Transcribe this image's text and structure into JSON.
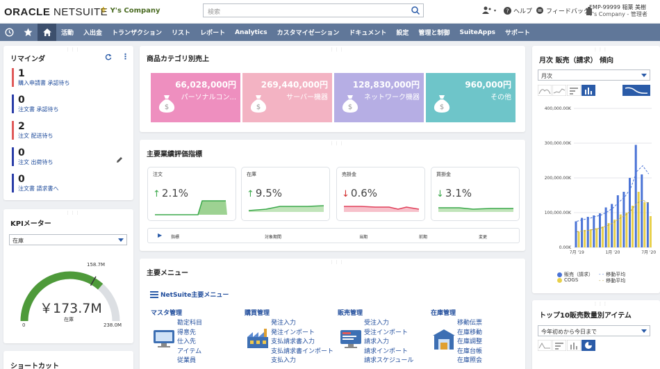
{
  "header": {
    "logo_oracle": "ORACLE",
    "logo_netsuite": "NETSUITE",
    "company": "Y's Company",
    "search_placeholder": "検索",
    "help": "ヘルプ",
    "feedback": "フィードバック",
    "user_name": "EMP-99999 稲葉 美樹",
    "user_role": "Y's Company - 管理者"
  },
  "nav": {
    "items": [
      "活動",
      "入出金",
      "トランザクション",
      "リスト",
      "レポート",
      "Analytics",
      "カスタマイゼーション",
      "ドキュメント",
      "設定",
      "管理と制御",
      "SuiteApps",
      "サポート"
    ]
  },
  "reminders": {
    "title": "リマインダ",
    "items": [
      {
        "count": "1",
        "label": "購入申請書 承認待ち",
        "color": "#e05a5a"
      },
      {
        "count": "0",
        "label": "注文書 承認待ち",
        "color": "#2a3da8"
      },
      {
        "count": "2",
        "label": "注文 配送待ち",
        "color": "#e05a5a"
      },
      {
        "count": "0",
        "label": "注文 出荷待ち",
        "color": "#2a3da8"
      },
      {
        "count": "0",
        "label": "注文書 請求書へ",
        "color": "#2a3da8"
      }
    ]
  },
  "kpi_meter": {
    "title": "KPIメーター",
    "select_value": "在庫",
    "value": "￥173.7M",
    "label": "在庫",
    "min": "0",
    "max": "238.0M",
    "target": "158.7M"
  },
  "shortcut": {
    "title": "ショートカット"
  },
  "category_sales": {
    "title": "商品カテゴリ別売上",
    "tiles": [
      {
        "amount": "66,028,000円",
        "name": "パーソナルコン...",
        "color": "#ee8fbf"
      },
      {
        "amount": "269,440,000円",
        "name": "サーバー機器",
        "color": "#f3b3c3"
      },
      {
        "amount": "128,830,000円",
        "name": "ネットワーク機器",
        "color": "#b6aee4"
      },
      {
        "amount": "960,000円",
        "name": "その他",
        "color": "#6ec5c9"
      }
    ]
  },
  "key_kpis": {
    "title": "主要業績評価指標",
    "cards": [
      {
        "label": "注文",
        "value": "2.1%",
        "arrow": "↑",
        "arrow_color": "#3aa84a",
        "line_color": "#3aa84a"
      },
      {
        "label": "在庫",
        "value": "9.5%",
        "arrow": "↑",
        "arrow_color": "#3aa84a",
        "line_color": "#3aa84a"
      },
      {
        "label": "売掛金",
        "value": "0.6%",
        "arrow": "↓",
        "arrow_color": "#d22b2b",
        "line_color": "#e0405a"
      },
      {
        "label": "買掛金",
        "value": "3.1%",
        "arrow": "↓",
        "arrow_color": "#3aa84a",
        "line_color": "#3aa84a"
      }
    ],
    "table_headers": [
      "指標",
      "対象期間",
      "当期",
      "前期",
      "変更"
    ]
  },
  "main_menu": {
    "title": "主要メニュー",
    "link": "NetSuite主要メニュー",
    "columns": [
      {
        "heading": "マスタ管理",
        "links": [
          "勘定科目",
          "得意先",
          "仕入先",
          "アイテム",
          "従業員"
        ]
      },
      {
        "heading": "購買管理",
        "links": [
          "発注入力",
          "発注インポート",
          "支払請求書入力",
          "支払請求書インポート",
          "支払入力"
        ]
      },
      {
        "heading": "販売管理",
        "links": [
          "受注入力",
          "受注インポート",
          "請求入力",
          "請求インポート",
          "請求スケジュール"
        ]
      },
      {
        "heading": "在庫管理",
        "links": [
          "移動伝票",
          "在庫移動",
          "在庫調整",
          "在庫台帳",
          "在庫照会"
        ]
      }
    ]
  },
  "monthly_trend": {
    "title": "月次 販売（請求） 傾向",
    "select_value": "月次",
    "legend": [
      "販売（請求）",
      "移動平均",
      "COGS",
      "移動平均"
    ],
    "colors": {
      "sales": "#4a73d6",
      "cogs": "#e8d04a",
      "avg_sales": "#4a73d6",
      "avg_cogs": "#b8a042"
    }
  },
  "top10": {
    "title": "トップ10販売数量別アイテム",
    "select_value": "今年初めから今日まで"
  },
  "chart_data": {
    "type": "bar",
    "title": "月次 販売（請求） 傾向",
    "x_tick_labels": [
      "7月 '19",
      "1月 '20",
      "7月 '20"
    ],
    "y_tick_labels": [
      "0.00K",
      "100,000.00K",
      "200,000.00K",
      "300,000.00K",
      "400,000.00K"
    ],
    "ylim": [
      0,
      400000
    ],
    "categories": [
      "7月 '19",
      "8月 '19",
      "9月 '19",
      "10月 '19",
      "11月 '19",
      "12月 '19",
      "1月 '20",
      "2月 '20",
      "3月 '20",
      "4月 '20",
      "5月 '20",
      "6月 '20",
      "7月 '20"
    ],
    "series": [
      {
        "name": "販売（請求）",
        "values": [
          75000,
          85000,
          88000,
          92000,
          98000,
          115000,
          125000,
          150000,
          160000,
          200000,
          295000,
          210000,
          130000
        ]
      },
      {
        "name": "COGS",
        "values": [
          45000,
          50000,
          52000,
          55000,
          60000,
          70000,
          80000,
          95000,
          100000,
          120000,
          160000,
          130000,
          90000
        ]
      }
    ]
  }
}
